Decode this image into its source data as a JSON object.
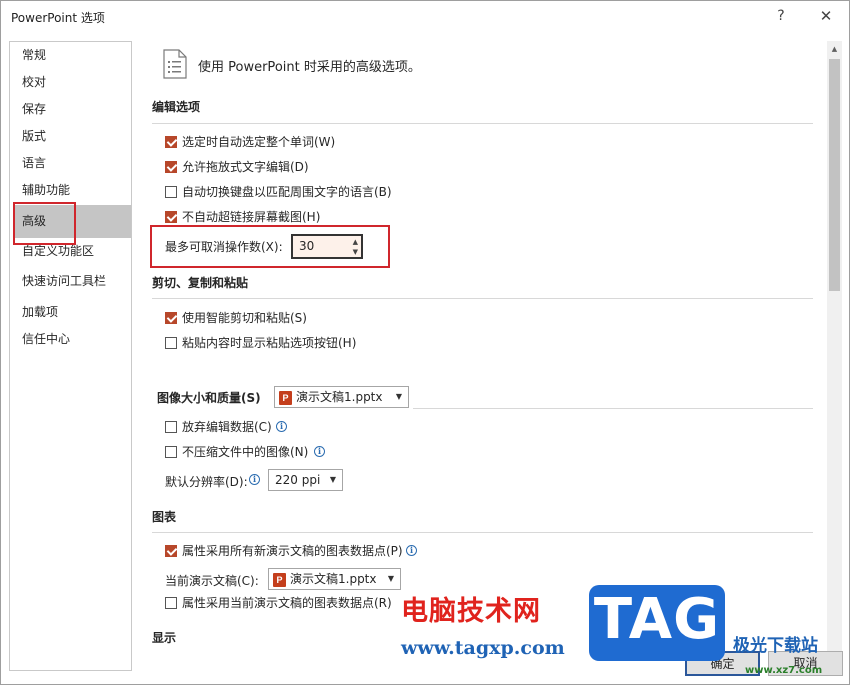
{
  "window": {
    "title": "PowerPoint 选项",
    "help_label": "?",
    "close_label": "✕"
  },
  "sidebar": {
    "items": [
      {
        "label": "常规"
      },
      {
        "label": "校对"
      },
      {
        "label": "保存"
      },
      {
        "label": "版式"
      },
      {
        "label": "语言"
      },
      {
        "label": "辅助功能"
      },
      {
        "label": "高级"
      },
      {
        "label": "自定义功能区"
      },
      {
        "label": "快速访问工具栏"
      },
      {
        "label": "加载项"
      },
      {
        "label": "信任中心"
      }
    ],
    "selected": "高级"
  },
  "header": {
    "text": "使用 PowerPoint 时采用的高级选项。",
    "icon": "document-options-icon"
  },
  "editing": {
    "title": "编辑选项",
    "options": [
      {
        "label": "选定时自动选定整个单词(W)",
        "checked": true
      },
      {
        "label": "允许拖放式文字编辑(D)",
        "checked": true
      },
      {
        "label": "自动切换键盘以匹配周围文字的语言(B)",
        "checked": false
      },
      {
        "label": "不自动超链接屏幕截图(H)",
        "checked": true
      }
    ],
    "undo_label": "最多可取消操作数(X):",
    "undo_value": "30"
  },
  "clipboard": {
    "title": "剪切、复制和粘贴",
    "options": [
      {
        "label": "使用智能剪切和粘贴(S)",
        "checked": true
      },
      {
        "label": "粘贴内容时显示粘贴选项按钮(H)",
        "checked": false
      }
    ]
  },
  "image": {
    "title": "图像大小和质量(S)",
    "file": "演示文稿1.pptx",
    "options": [
      {
        "label": "放弃编辑数据(C)",
        "checked": false
      },
      {
        "label": "不压缩文件中的图像(N)",
        "checked": false
      }
    ],
    "resolution_label": "默认分辨率(D):",
    "resolution_value": "220 ppi"
  },
  "chart": {
    "title": "图表",
    "options": [
      {
        "label": "属性采用所有新演示文稿的图表数据点(P)",
        "checked": true
      },
      {
        "label": "属性采用当前演示文稿的图表数据点(R)",
        "checked": false
      }
    ],
    "current_label": "当前演示文稿(C):",
    "current_file": "演示文稿1.pptx"
  },
  "display": {
    "title": "显示"
  },
  "buttons": {
    "ok": "确定",
    "cancel": "取消"
  },
  "watermark": {
    "cn": "电脑技术网",
    "url": "www.tagxp.com",
    "tag": "TAG",
    "site2": "极光下载站",
    "url2": "www.xz7.com"
  },
  "colors": {
    "accent": "#b7472a",
    "highlight_red": "#d0262c",
    "selected_nav": "#c5c5c5",
    "watermark_blue": "#1f6bd1"
  }
}
